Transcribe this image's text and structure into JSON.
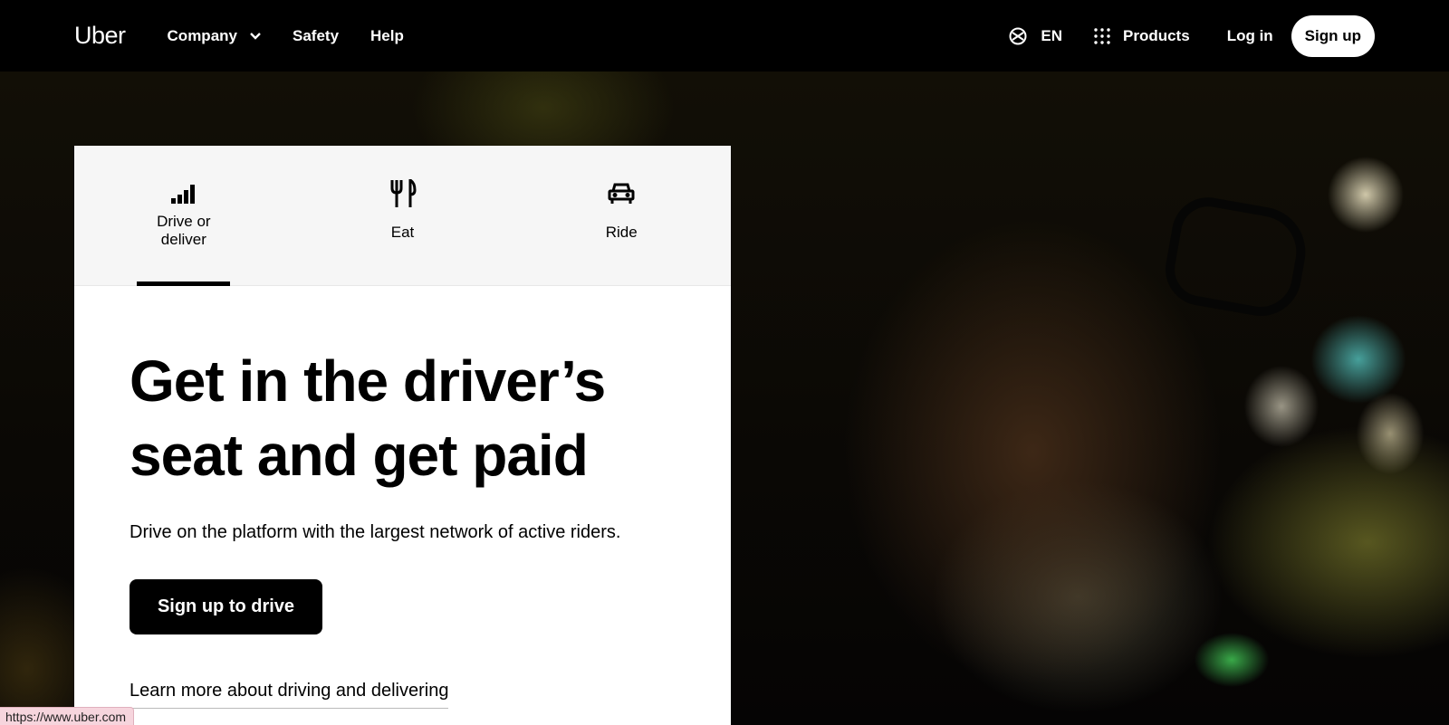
{
  "nav": {
    "logo": "Uber",
    "links": [
      {
        "label": "Company"
      },
      {
        "label": "Safety"
      },
      {
        "label": "Help"
      }
    ],
    "language": "EN",
    "products": "Products",
    "login": "Log in",
    "signup": "Sign up"
  },
  "tabs": [
    {
      "label": "Drive or deliver",
      "icon": "signal-bars-icon",
      "active": true
    },
    {
      "label": "Eat",
      "icon": "fork-knife-icon",
      "active": false
    },
    {
      "label": "Ride",
      "icon": "car-icon",
      "active": false
    }
  ],
  "hero": {
    "headline": "Get in the driver’s seat and get paid",
    "subtitle": "Drive on the platform with the largest network of active riders.",
    "cta": "Sign up to drive",
    "learn_more": "Learn more about driving and delivering"
  },
  "status_url": "https://www.uber.com",
  "colors": {
    "nav_bg": "#000000",
    "card_bg": "#ffffff",
    "tabs_bg": "#f6f6f6",
    "cta_bg": "#000000",
    "status_bg": "#f6d5dd"
  }
}
